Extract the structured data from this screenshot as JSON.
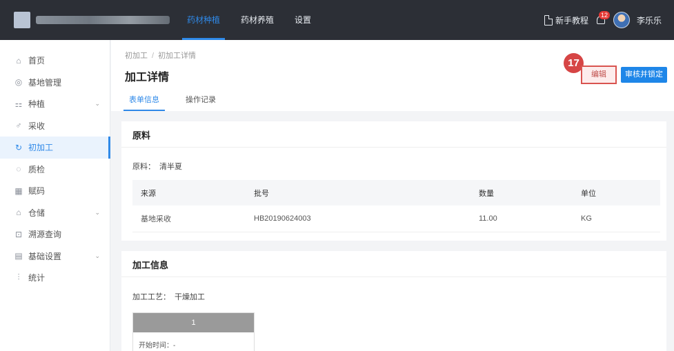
{
  "topbar": {
    "nav": [
      "药材种植",
      "药材养殖",
      "设置"
    ],
    "active_nav": 0,
    "tutorial_label": "新手教程",
    "notification_count": "12",
    "user_name": "李乐乐"
  },
  "sidebar": {
    "items": [
      {
        "label": "首页",
        "icon": "⌂",
        "expandable": false
      },
      {
        "label": "基地管理",
        "icon": "◎",
        "expandable": false
      },
      {
        "label": "种植",
        "icon": "⚏",
        "expandable": true
      },
      {
        "label": "采收",
        "icon": "♂",
        "expandable": false
      },
      {
        "label": "初加工",
        "icon": "↻",
        "expandable": false
      },
      {
        "label": "质检",
        "icon": "◌",
        "expandable": false
      },
      {
        "label": "赋码",
        "icon": "▦",
        "expandable": false
      },
      {
        "label": "仓储",
        "icon": "⌂",
        "expandable": true
      },
      {
        "label": "溯源查询",
        "icon": "⊡",
        "expandable": false
      },
      {
        "label": "基础设置",
        "icon": "▤",
        "expandable": true
      },
      {
        "label": "统计",
        "icon": "⫶",
        "expandable": false
      }
    ],
    "active_index": 4
  },
  "header": {
    "breadcrumb": [
      "初加工",
      "初加工详情"
    ],
    "title": "加工详情",
    "tabs": [
      "表单信息",
      "操作记录"
    ],
    "active_tab": 0,
    "step_badge": "17",
    "edit_label": "编辑",
    "audit_label": "审核并锁定"
  },
  "raw_material": {
    "title": "原料",
    "material_label": "原料：",
    "material_value": "清半夏",
    "columns": [
      "来源",
      "批号",
      "数量",
      "单位"
    ],
    "rows": [
      [
        "基地采收",
        "HB20190624003",
        "11.00",
        "KG"
      ]
    ]
  },
  "processing": {
    "title": "加工信息",
    "process_label": "加工工艺：",
    "process_value": "干燥加工",
    "stage_number": "1",
    "start_time_label": "开始时间：-"
  },
  "colors": {
    "topbar": "#2c2f36",
    "accent": "#2f89e8",
    "highlight": "#d64545"
  }
}
